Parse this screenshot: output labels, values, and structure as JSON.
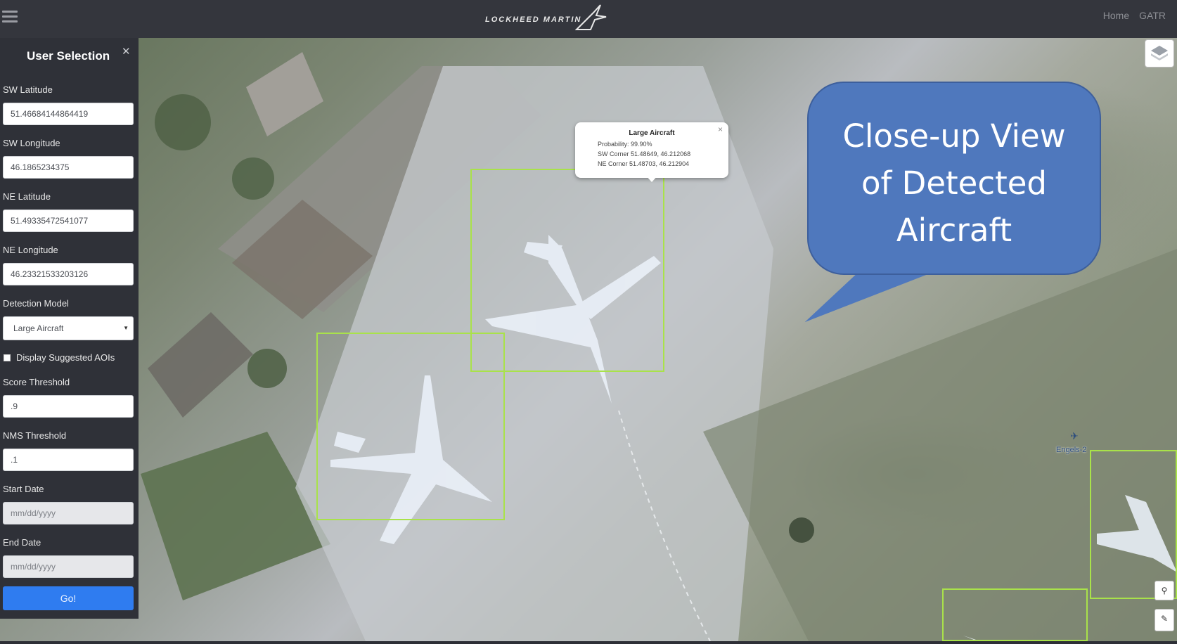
{
  "header": {
    "menu_icon": "hamburger-icon",
    "logo_text": "LOCKHEED MARTIN",
    "nav": [
      "Home",
      "GATR"
    ]
  },
  "sidebar": {
    "title": "User Selection",
    "close_icon": "close-icon",
    "sw_latitude": {
      "label": "SW Latitude",
      "value": "51.46684144864419"
    },
    "sw_longitude": {
      "label": "SW Longitude",
      "value": "46.1865234375"
    },
    "ne_latitude": {
      "label": "NE Latitude",
      "value": "51.49335472541077"
    },
    "ne_longitude": {
      "label": "NE Longitude",
      "value": "46.23321533203126"
    },
    "detection_model": {
      "label": "Detection Model",
      "value": "Large Aircraft"
    },
    "suggested_aois": {
      "label": "Display Suggested AOIs",
      "checked": false
    },
    "score_threshold": {
      "label": "Score Threshold",
      "value": ".9"
    },
    "nms_threshold": {
      "label": "NMS Threshold",
      "value": ".1"
    },
    "start_date": {
      "label": "Start Date",
      "placeholder": "mm/dd/yyyy"
    },
    "end_date": {
      "label": "End Date",
      "placeholder": "mm/dd/yyyy"
    },
    "submit_label": "Go!"
  },
  "popup": {
    "title": "Large Aircraft",
    "probability": "Probability: 99.90%",
    "sw_corner": "SW Corner 51.48649, 46.212068",
    "ne_corner": "NE Corner 51.48703, 46.212904",
    "close": "×"
  },
  "callout": {
    "line1": "Close-up View",
    "line2": "of Detected",
    "line3": "Aircraft"
  },
  "map": {
    "place_label": "Engels-2",
    "layers_icon": "layers-icon",
    "marker_icon": "location-pin-icon",
    "edit_icon": "edit-icon",
    "delete_icon": "trash-icon",
    "detection_color": "#a9e24a"
  },
  "colors": {
    "topbar": "#34363d",
    "sidebar": "#2f3138",
    "button": "#2f7cf0",
    "callout": "#4f78bd"
  }
}
